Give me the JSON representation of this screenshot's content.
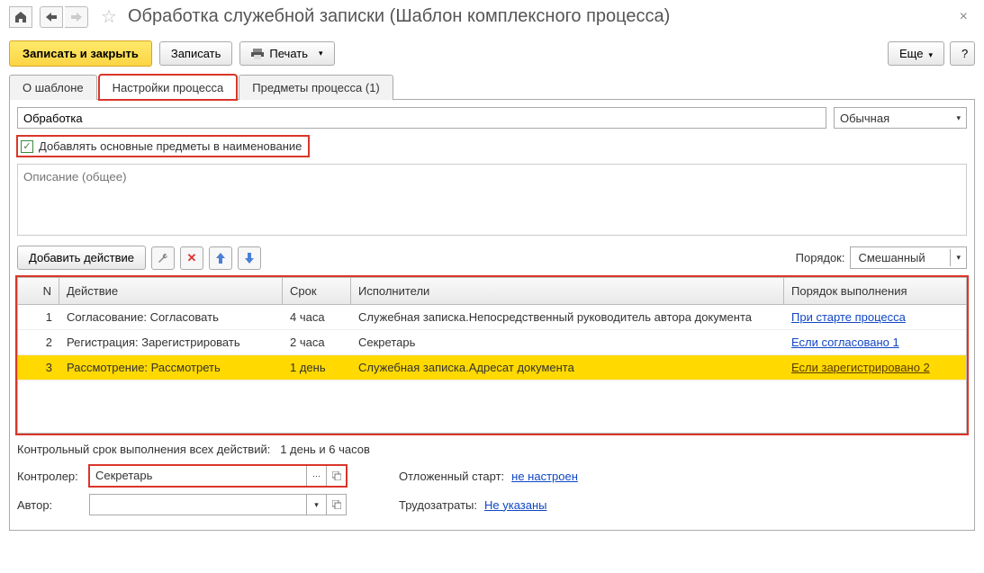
{
  "title": "Обработка служебной записки (Шаблон комплексного процесса)",
  "toolbar": {
    "save_close": "Записать и закрыть",
    "save": "Записать",
    "print": "Печать",
    "more": "Еще",
    "help": "?"
  },
  "tabs": {
    "about": "О шаблоне",
    "settings": "Настройки процесса",
    "subjects": "Предметы процесса (1)"
  },
  "form": {
    "name": "Обработка",
    "type": "Обычная",
    "add_subjects_label": "Добавлять основные предметы в наименование",
    "desc_placeholder": "Описание (общее)"
  },
  "actions": {
    "add": "Добавить действие",
    "order_label": "Порядок:",
    "order_value": "Смешанный"
  },
  "table": {
    "headers": {
      "n": "N",
      "action": "Действие",
      "due": "Срок",
      "exec": "Исполнители",
      "order": "Порядок выполнения"
    },
    "rows": [
      {
        "n": "1",
        "action": "Согласование: Согласовать",
        "due": "4 часа",
        "exec": "Служебная записка.Непосредственный руководитель автора документа",
        "order": "При старте процесса"
      },
      {
        "n": "2",
        "action": "Регистрация: Зарегистрировать",
        "due": "2 часа",
        "exec": "Секретарь",
        "order": "Если согласовано 1"
      },
      {
        "n": "3",
        "action": "Рассмотрение: Рассмотреть",
        "due": "1 день",
        "exec": "Служебная записка.Адресат документа",
        "order": "Если зарегистрировано 2"
      }
    ]
  },
  "summary": {
    "label": "Контрольный срок выполнения всех действий:",
    "value": "1 день и 6 часов"
  },
  "bottom": {
    "controller_label": "Контролер:",
    "controller_value": "Секретарь",
    "author_label": "Автор:",
    "author_value": "",
    "deferred_label": "Отложенный старт:",
    "deferred_value": "не настроен",
    "effort_label": "Трудозатраты:",
    "effort_value": "Не указаны"
  }
}
